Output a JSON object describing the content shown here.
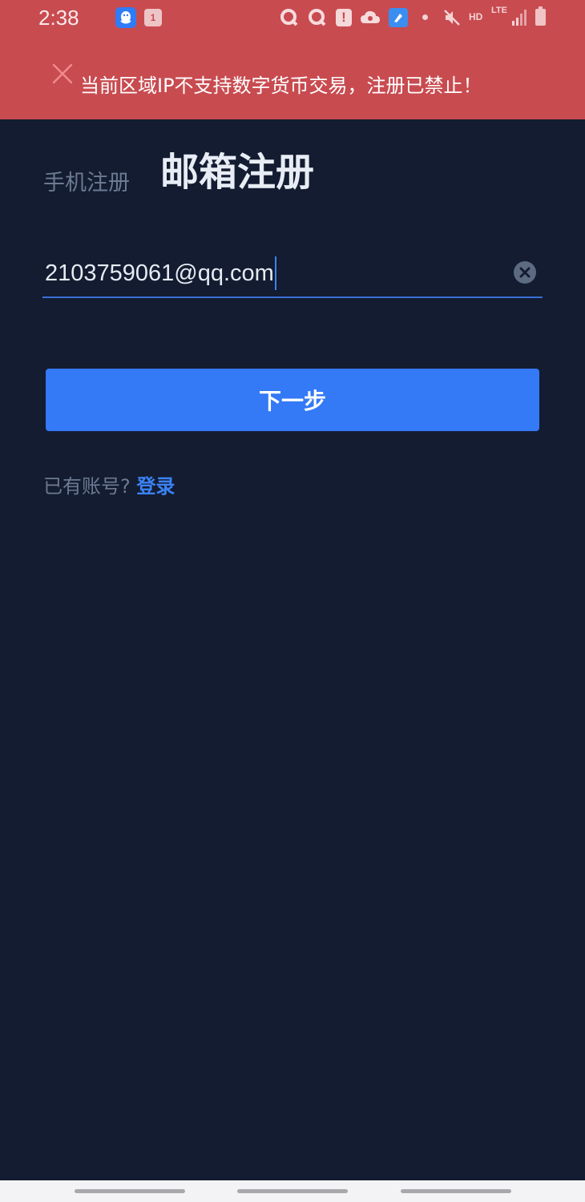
{
  "status_bar": {
    "time": "2:38",
    "calendar_badge": "1",
    "alert_badge": "!",
    "network_hd": "HD",
    "network_lte": "LTE"
  },
  "banner": {
    "message": "当前区域IP不支持数字货币交易，注册已禁止！",
    "color": "#c84b50"
  },
  "tabs": {
    "phone": "手机注册",
    "email": "邮箱注册",
    "active": "email"
  },
  "email_field": {
    "value": "2103759061@qq.com"
  },
  "next_button": {
    "label": "下一步",
    "color": "#3479f5"
  },
  "login": {
    "prompt": "已有账号?",
    "link": "登录"
  },
  "icons": {
    "close": "close-icon",
    "clear": "clear-icon",
    "qq": "qq-icon"
  },
  "colors": {
    "background": "#131c30",
    "accent": "#3b82f6"
  }
}
